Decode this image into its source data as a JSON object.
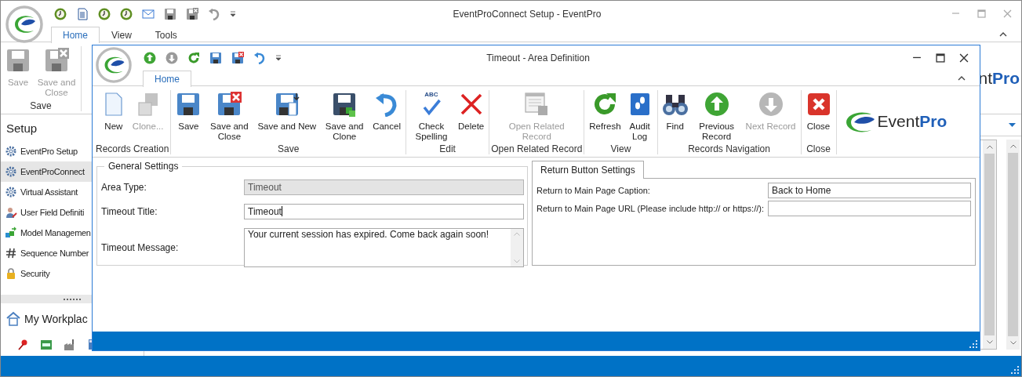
{
  "main_window": {
    "title": "EventProConnect Setup - EventPro",
    "tabs": [
      {
        "label": "Home",
        "selected": true
      },
      {
        "label": "View",
        "selected": false
      },
      {
        "label": "Tools",
        "selected": false
      }
    ],
    "ribbon": {
      "groups": [
        {
          "label": "Save",
          "buttons": [
            {
              "label": "Save",
              "disabled": true
            },
            {
              "label": "Save and Close",
              "disabled": true
            }
          ]
        }
      ]
    },
    "logo_text": "nt**Pro**",
    "sidebar": {
      "title": "Setup",
      "items": [
        {
          "label": "EventPro Setup",
          "selected": false
        },
        {
          "label": "EventProConnect",
          "selected": true
        },
        {
          "label": "Virtual Assistant",
          "selected": false
        },
        {
          "label": "User Field Definiti",
          "selected": false
        },
        {
          "label": "Model Managemen",
          "selected": false
        },
        {
          "label": "Sequence Number",
          "selected": false
        },
        {
          "label": "Security",
          "selected": false
        }
      ],
      "workplace": "My Workplac"
    }
  },
  "dialog": {
    "title": "Timeout - Area Definition",
    "tabs": [
      {
        "label": "Home",
        "selected": true
      }
    ],
    "ribbon": {
      "groups": [
        {
          "label": "Records Creation",
          "buttons": [
            {
              "label": "New",
              "disabled": false
            },
            {
              "label": "Clone...",
              "disabled": true
            }
          ]
        },
        {
          "label": "Save",
          "buttons": [
            {
              "label": "Save",
              "disabled": false
            },
            {
              "label": "Save and Close",
              "disabled": false
            },
            {
              "label": "Save and New",
              "disabled": false
            },
            {
              "label": "Save and Clone",
              "disabled": false
            },
            {
              "label": "Cancel",
              "disabled": false
            }
          ]
        },
        {
          "label": "Edit",
          "buttons": [
            {
              "label": "Check Spelling",
              "disabled": false,
              "icon_caption": "ABC"
            },
            {
              "label": "Delete",
              "disabled": false
            }
          ]
        },
        {
          "label": "Open Related Record",
          "buttons": [
            {
              "label": "Open Related Record",
              "disabled": true
            }
          ]
        },
        {
          "label": "View",
          "buttons": [
            {
              "label": "Refresh",
              "disabled": false
            },
            {
              "label": "Audit Log",
              "disabled": false
            }
          ]
        },
        {
          "label": "Records Navigation",
          "buttons": [
            {
              "label": "Find",
              "disabled": false
            },
            {
              "label": "Previous Record",
              "disabled": false
            },
            {
              "label": "Next Record",
              "disabled": true
            }
          ]
        },
        {
          "label": "Close",
          "buttons": [
            {
              "label": "Close",
              "disabled": false
            }
          ]
        }
      ]
    },
    "logo_text": "Event**Pro**",
    "general_settings": {
      "title": "General Settings",
      "fields": [
        {
          "kind": "text",
          "label": "Area Type:",
          "value": "Timeout",
          "disabled": true,
          "focused": false
        },
        {
          "kind": "text",
          "label": "Timeout Title:",
          "value": "Timeout",
          "disabled": false,
          "focused": true
        },
        {
          "kind": "memo",
          "label": "Timeout Message:",
          "value": "Your current session has expired. Come back again soon!",
          "disabled": false,
          "focused": false
        }
      ]
    },
    "return_settings": {
      "tab": {
        "label": "Return Button Settings",
        "selected": true
      },
      "fields": [
        {
          "kind": "text",
          "label": "Return to Main Page Caption:",
          "value": "Back to Home",
          "disabled": false,
          "focused": false
        },
        {
          "kind": "text",
          "label": "Return to Main Page URL (Please include http:// or https://):",
          "disabled": false,
          "focused": false
        }
      ]
    }
  }
}
